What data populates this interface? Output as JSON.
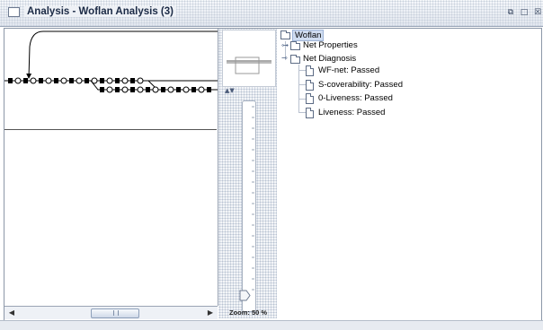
{
  "window": {
    "title": "Analysis - Woflan Analysis (3)",
    "buttons": [
      "restore-icon",
      "maximize-icon",
      "close-icon"
    ]
  },
  "tree": {
    "root": "Woflan",
    "items": [
      {
        "label": "Net Properties",
        "expanded": false
      },
      {
        "label": "Net Diagnosis",
        "expanded": true,
        "children": [
          "WF-net: Passed",
          "S-coverability: Passed",
          "0-Liveness: Passed",
          "Liveness: Passed"
        ]
      }
    ]
  },
  "zoom": {
    "label": "Zoom: 50 %",
    "value": 50
  },
  "colors": {
    "selection": "#cfdcf0",
    "titlebar_text": "#1b2a45"
  }
}
